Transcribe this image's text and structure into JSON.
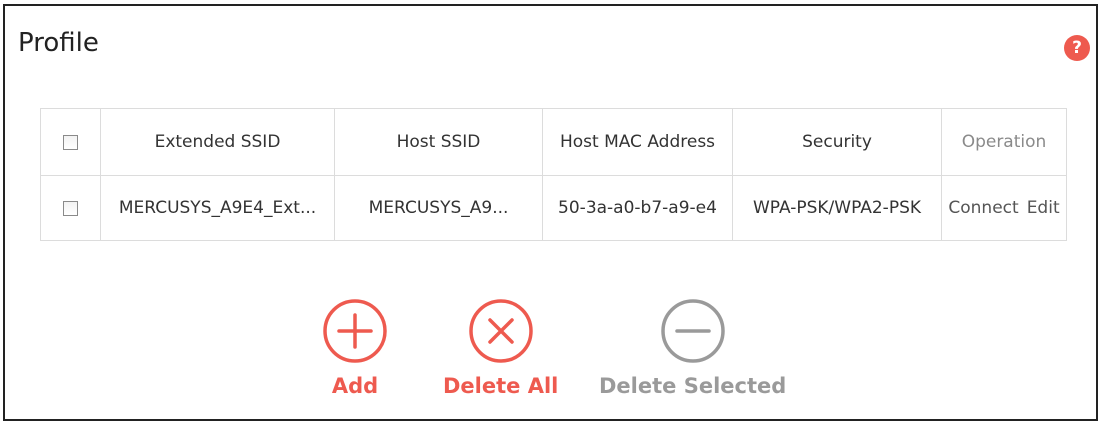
{
  "page": {
    "title": "Profile",
    "help_icon_glyph": "?"
  },
  "colors": {
    "accent": "#ee5a4f",
    "disabled": "#9a9a9a",
    "border": "#dcdcdc"
  },
  "table": {
    "headers": [
      "Extended SSID",
      "Host SSID",
      "Host MAC Address",
      "Security",
      "Operation"
    ],
    "rows": [
      {
        "checked": false,
        "extended_ssid": "MERCUSYS_A9E4_Ext...",
        "host_ssid": "MERCUSYS_A9...",
        "host_mac": "50-3a-a0-b7-a9-e4",
        "security": "WPA-PSK/WPA2-PSK",
        "operations": [
          "Connect",
          "Edit"
        ]
      }
    ]
  },
  "actions": {
    "add": {
      "label": "Add",
      "icon": "plus-circle-icon"
    },
    "delete_all": {
      "label": "Delete All",
      "icon": "x-circle-icon"
    },
    "delete_selected": {
      "label": "Delete Selected",
      "icon": "minus-circle-icon",
      "disabled": true
    }
  }
}
